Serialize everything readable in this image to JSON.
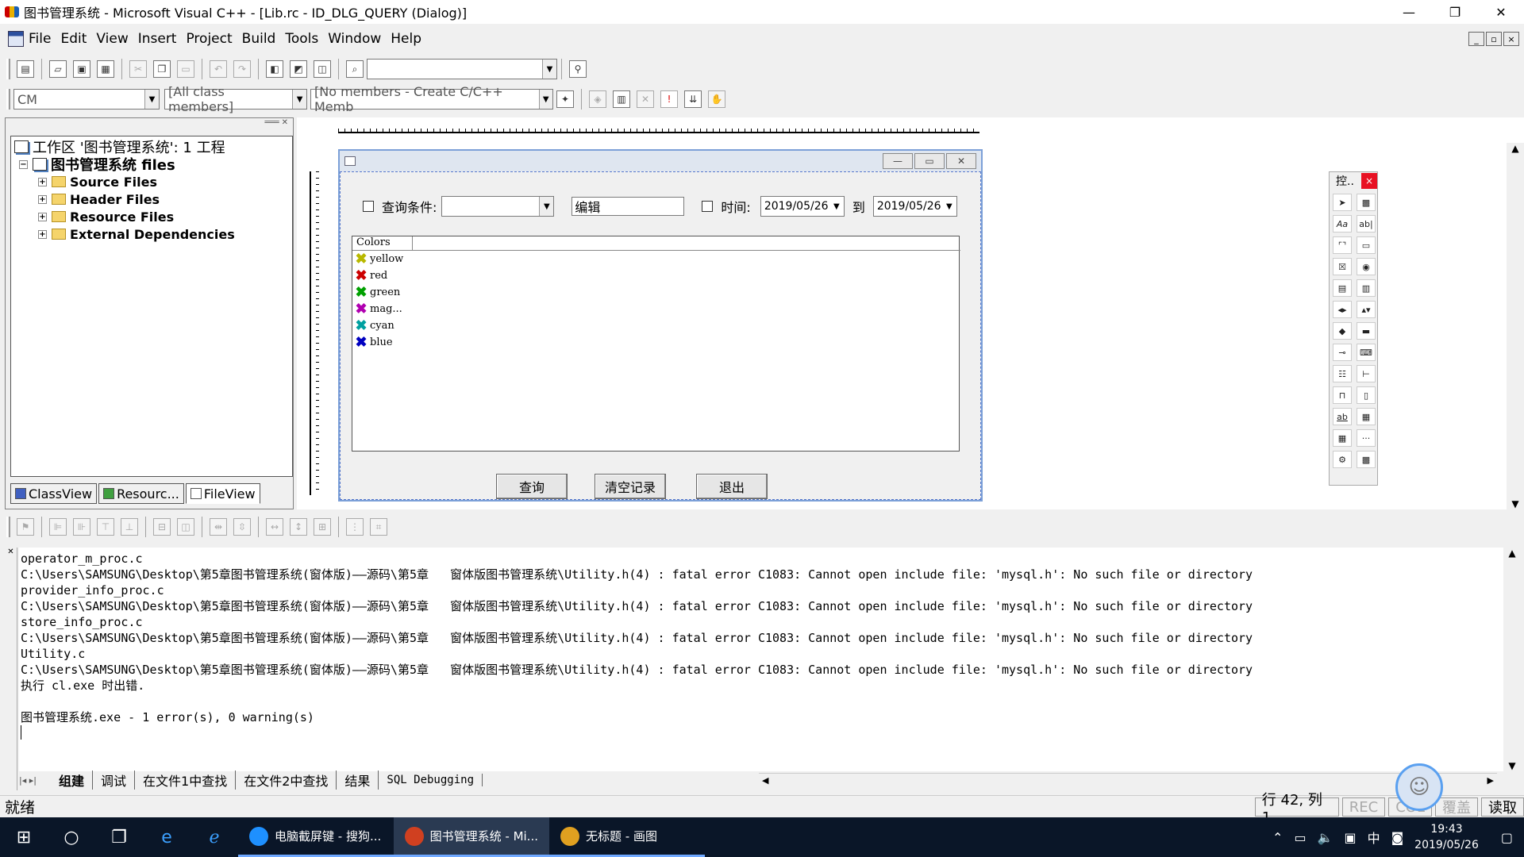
{
  "window": {
    "title": "图书管理系统 - Microsoft Visual C++ - [Lib.rc - ID_DLG_QUERY (Dialog)]",
    "min": "—",
    "restore": "❐",
    "close": "✕"
  },
  "menu": [
    "File",
    "Edit",
    "View",
    "Insert",
    "Project",
    "Build",
    "Tools",
    "Window",
    "Help"
  ],
  "mdi_buttons": {
    "min": "_",
    "restore": "▫",
    "close": "×"
  },
  "wizard_bar": {
    "class_combo": "CM",
    "filter_combo": "[All class members]",
    "members_combo": "[No members - Create C/C++ Memb"
  },
  "workspace": {
    "tree": [
      {
        "label": "工作区 '图书管理系统': 1 工程",
        "level": 0,
        "kind": "workspace"
      },
      {
        "label": "图书管理系统 files",
        "level": 1,
        "kind": "project"
      },
      {
        "label": "Source Files",
        "level": 2,
        "kind": "folder"
      },
      {
        "label": "Header Files",
        "level": 2,
        "kind": "folder"
      },
      {
        "label": "Resource Files",
        "level": 2,
        "kind": "folder"
      },
      {
        "label": "External Dependencies",
        "level": 2,
        "kind": "folder"
      }
    ],
    "tabs": [
      "ClassView",
      "Resourc...",
      "FileView"
    ]
  },
  "dialog": {
    "query_condition_label": "查询条件:",
    "edit_value": "编辑",
    "time_label": "时间:",
    "date_from": "2019/05/26",
    "to_label": "到",
    "date_to": "2019/05/26",
    "list_header": "Colors",
    "list_items": [
      {
        "label": "yellow",
        "color": "#b8b800"
      },
      {
        "label": "red",
        "color": "#cc0000"
      },
      {
        "label": "green",
        "color": "#00a000"
      },
      {
        "label": "mag...",
        "color": "#b000b0"
      },
      {
        "label": "cyan",
        "color": "#00a0a0"
      },
      {
        "label": "blue",
        "color": "#0000c0"
      }
    ],
    "buttons": {
      "query": "查询",
      "clear": "清空记录",
      "exit": "退出"
    }
  },
  "palette": {
    "title": "控..",
    "close": "×"
  },
  "output": {
    "lines": [
      "operator_m_proc.c",
      "C:\\Users\\SAMSUNG\\Desktop\\第5章图书管理系统(窗体版)——源码\\第5章   窗体版图书管理系统\\Utility.h(4) : fatal error C1083: Cannot open include file: 'mysql.h': No such file or directory",
      "provider_info_proc.c",
      "C:\\Users\\SAMSUNG\\Desktop\\第5章图书管理系统(窗体版)——源码\\第5章   窗体版图书管理系统\\Utility.h(4) : fatal error C1083: Cannot open include file: 'mysql.h': No such file or directory",
      "store_info_proc.c",
      "C:\\Users\\SAMSUNG\\Desktop\\第5章图书管理系统(窗体版)——源码\\第5章   窗体版图书管理系统\\Utility.h(4) : fatal error C1083: Cannot open include file: 'mysql.h': No such file or directory",
      "Utility.c",
      "C:\\Users\\SAMSUNG\\Desktop\\第5章图书管理系统(窗体版)——源码\\第5章   窗体版图书管理系统\\Utility.h(4) : fatal error C1083: Cannot open include file: 'mysql.h': No such file or directory",
      "执行 cl.exe 时出错.",
      "",
      "图书管理系统.exe - 1 error(s), 0 warning(s)"
    ],
    "tabs": [
      "组建",
      "调试",
      "在文件1中查找",
      "在文件2中查找",
      "结果",
      "SQL Debugging"
    ]
  },
  "status": {
    "ready": "就绪",
    "position": "行 42, 列 1",
    "rec": "REC",
    "col": "COL",
    "ovr": "覆盖",
    "read": "读取"
  },
  "taskbar": {
    "apps": [
      {
        "label": "电脑截屏键 - 搜狗...",
        "color": "#1e90ff"
      },
      {
        "label": "图书管理系统 - Mi...",
        "color": "#d04020"
      },
      {
        "label": "无标题 - 画图",
        "color": "#e0a020"
      }
    ],
    "ime": "中",
    "time": "19:43",
    "date": "2019/05/26"
  }
}
